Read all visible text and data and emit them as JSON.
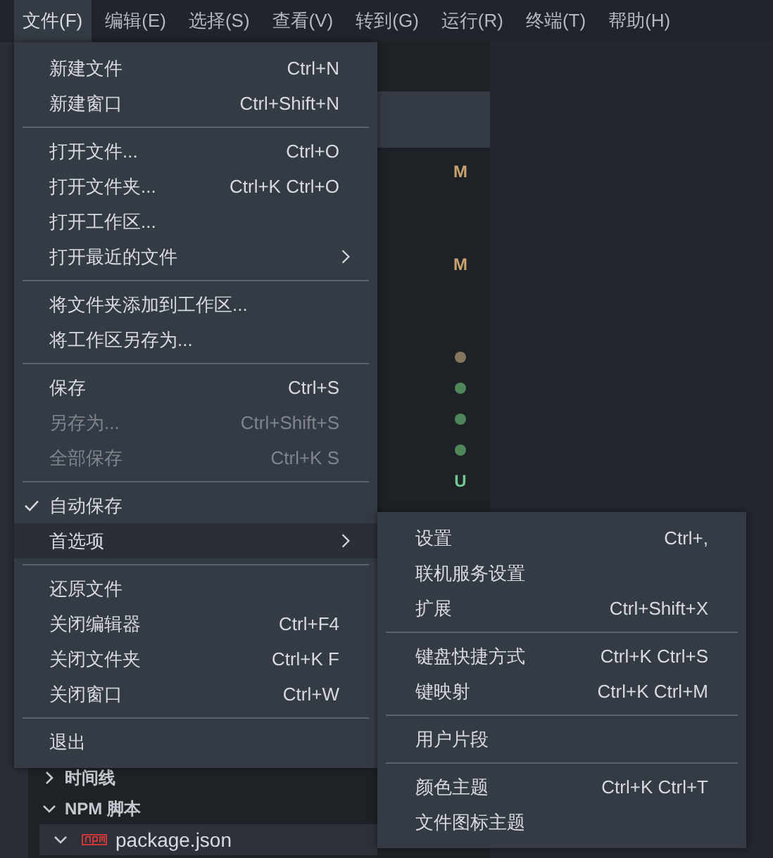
{
  "menubar": [
    {
      "label": "文件(F)",
      "selected": true
    },
    {
      "label": "编辑(E)",
      "selected": false
    },
    {
      "label": "选择(S)",
      "selected": false
    },
    {
      "label": "查看(V)",
      "selected": false
    },
    {
      "label": "转到(G)",
      "selected": false
    },
    {
      "label": "运行(R)",
      "selected": false
    },
    {
      "label": "终端(T)",
      "selected": false
    },
    {
      "label": "帮助(H)",
      "selected": false
    }
  ],
  "file_menu": {
    "items": [
      {
        "kind": "item",
        "label": "新建文件",
        "shortcut": "Ctrl+N",
        "disabled": false,
        "checked": false,
        "selected": false,
        "submenu": false
      },
      {
        "kind": "item",
        "label": "新建窗口",
        "shortcut": "Ctrl+Shift+N",
        "disabled": false,
        "checked": false,
        "selected": false,
        "submenu": false
      },
      {
        "kind": "separator"
      },
      {
        "kind": "item",
        "label": "打开文件...",
        "shortcut": "Ctrl+O",
        "disabled": false,
        "checked": false,
        "selected": false,
        "submenu": false
      },
      {
        "kind": "item",
        "label": "打开文件夹...",
        "shortcut": "Ctrl+K Ctrl+O",
        "disabled": false,
        "checked": false,
        "selected": false,
        "submenu": false
      },
      {
        "kind": "item",
        "label": "打开工作区...",
        "disabled": false,
        "checked": false,
        "selected": false,
        "submenu": false
      },
      {
        "kind": "item",
        "label": "打开最近的文件",
        "disabled": false,
        "checked": false,
        "selected": false,
        "submenu": true
      },
      {
        "kind": "separator"
      },
      {
        "kind": "item",
        "label": "将文件夹添加到工作区...",
        "disabled": false,
        "checked": false,
        "selected": false,
        "submenu": false
      },
      {
        "kind": "item",
        "label": "将工作区另存为...",
        "disabled": false,
        "checked": false,
        "selected": false,
        "submenu": false
      },
      {
        "kind": "separator"
      },
      {
        "kind": "item",
        "label": "保存",
        "shortcut": "Ctrl+S",
        "disabled": false,
        "checked": false,
        "selected": false,
        "submenu": false
      },
      {
        "kind": "item",
        "label": "另存为...",
        "shortcut": "Ctrl+Shift+S",
        "disabled": true,
        "checked": false,
        "selected": false,
        "submenu": false
      },
      {
        "kind": "item",
        "label": "全部保存",
        "shortcut": "Ctrl+K S",
        "disabled": true,
        "checked": false,
        "selected": false,
        "submenu": false
      },
      {
        "kind": "separator"
      },
      {
        "kind": "item",
        "label": "自动保存",
        "disabled": false,
        "checked": true,
        "selected": false,
        "submenu": false
      },
      {
        "kind": "item",
        "label": "首选项",
        "disabled": false,
        "checked": false,
        "selected": true,
        "submenu": true
      },
      {
        "kind": "separator"
      },
      {
        "kind": "item",
        "label": "还原文件",
        "disabled": false,
        "checked": false,
        "selected": false,
        "submenu": false
      },
      {
        "kind": "item",
        "label": "关闭编辑器",
        "shortcut": "Ctrl+F4",
        "disabled": false,
        "checked": false,
        "selected": false,
        "submenu": false
      },
      {
        "kind": "item",
        "label": "关闭文件夹",
        "shortcut": "Ctrl+K F",
        "disabled": false,
        "checked": false,
        "selected": false,
        "submenu": false
      },
      {
        "kind": "item",
        "label": "关闭窗口",
        "shortcut": "Ctrl+W",
        "disabled": false,
        "checked": false,
        "selected": false,
        "submenu": false
      },
      {
        "kind": "separator"
      },
      {
        "kind": "item",
        "label": "退出",
        "disabled": false,
        "checked": false,
        "selected": false,
        "submenu": false
      }
    ]
  },
  "preferences_submenu": {
    "items": [
      {
        "kind": "item",
        "label": "设置",
        "shortcut": "Ctrl+,"
      },
      {
        "kind": "item",
        "label": "联机服务设置"
      },
      {
        "kind": "item",
        "label": "扩展",
        "shortcut": "Ctrl+Shift+X"
      },
      {
        "kind": "separator"
      },
      {
        "kind": "item",
        "label": "键盘快捷方式",
        "shortcut": "Ctrl+K Ctrl+S"
      },
      {
        "kind": "item",
        "label": "键映射",
        "shortcut": "Ctrl+K Ctrl+M"
      },
      {
        "kind": "separator"
      },
      {
        "kind": "item",
        "label": "用户片段"
      },
      {
        "kind": "separator"
      },
      {
        "kind": "item",
        "label": "颜色主题",
        "shortcut": "Ctrl+K Ctrl+T"
      },
      {
        "kind": "item",
        "label": "文件图标主题"
      }
    ]
  },
  "git_markers": [
    {
      "kind": "letter",
      "text": "M",
      "color": "#c9a26d"
    },
    {
      "kind": "blank"
    },
    {
      "kind": "blank"
    },
    {
      "kind": "letter",
      "text": "M",
      "color": "#c9a26d"
    },
    {
      "kind": "blank"
    },
    {
      "kind": "blank"
    },
    {
      "kind": "dot",
      "color": "#84765c"
    },
    {
      "kind": "dot",
      "color": "#4f8559"
    },
    {
      "kind": "dot",
      "color": "#4f8559"
    },
    {
      "kind": "dot",
      "color": "#4f8559"
    },
    {
      "kind": "letter",
      "text": "U",
      "color": "#73c991"
    }
  ],
  "explorer": {
    "sections": [
      {
        "label": "时间线",
        "expanded": false
      },
      {
        "label": "NPM 脚本",
        "expanded": true,
        "children": [
          {
            "label": "package.json",
            "expanded": true,
            "selected": true
          }
        ]
      }
    ]
  }
}
